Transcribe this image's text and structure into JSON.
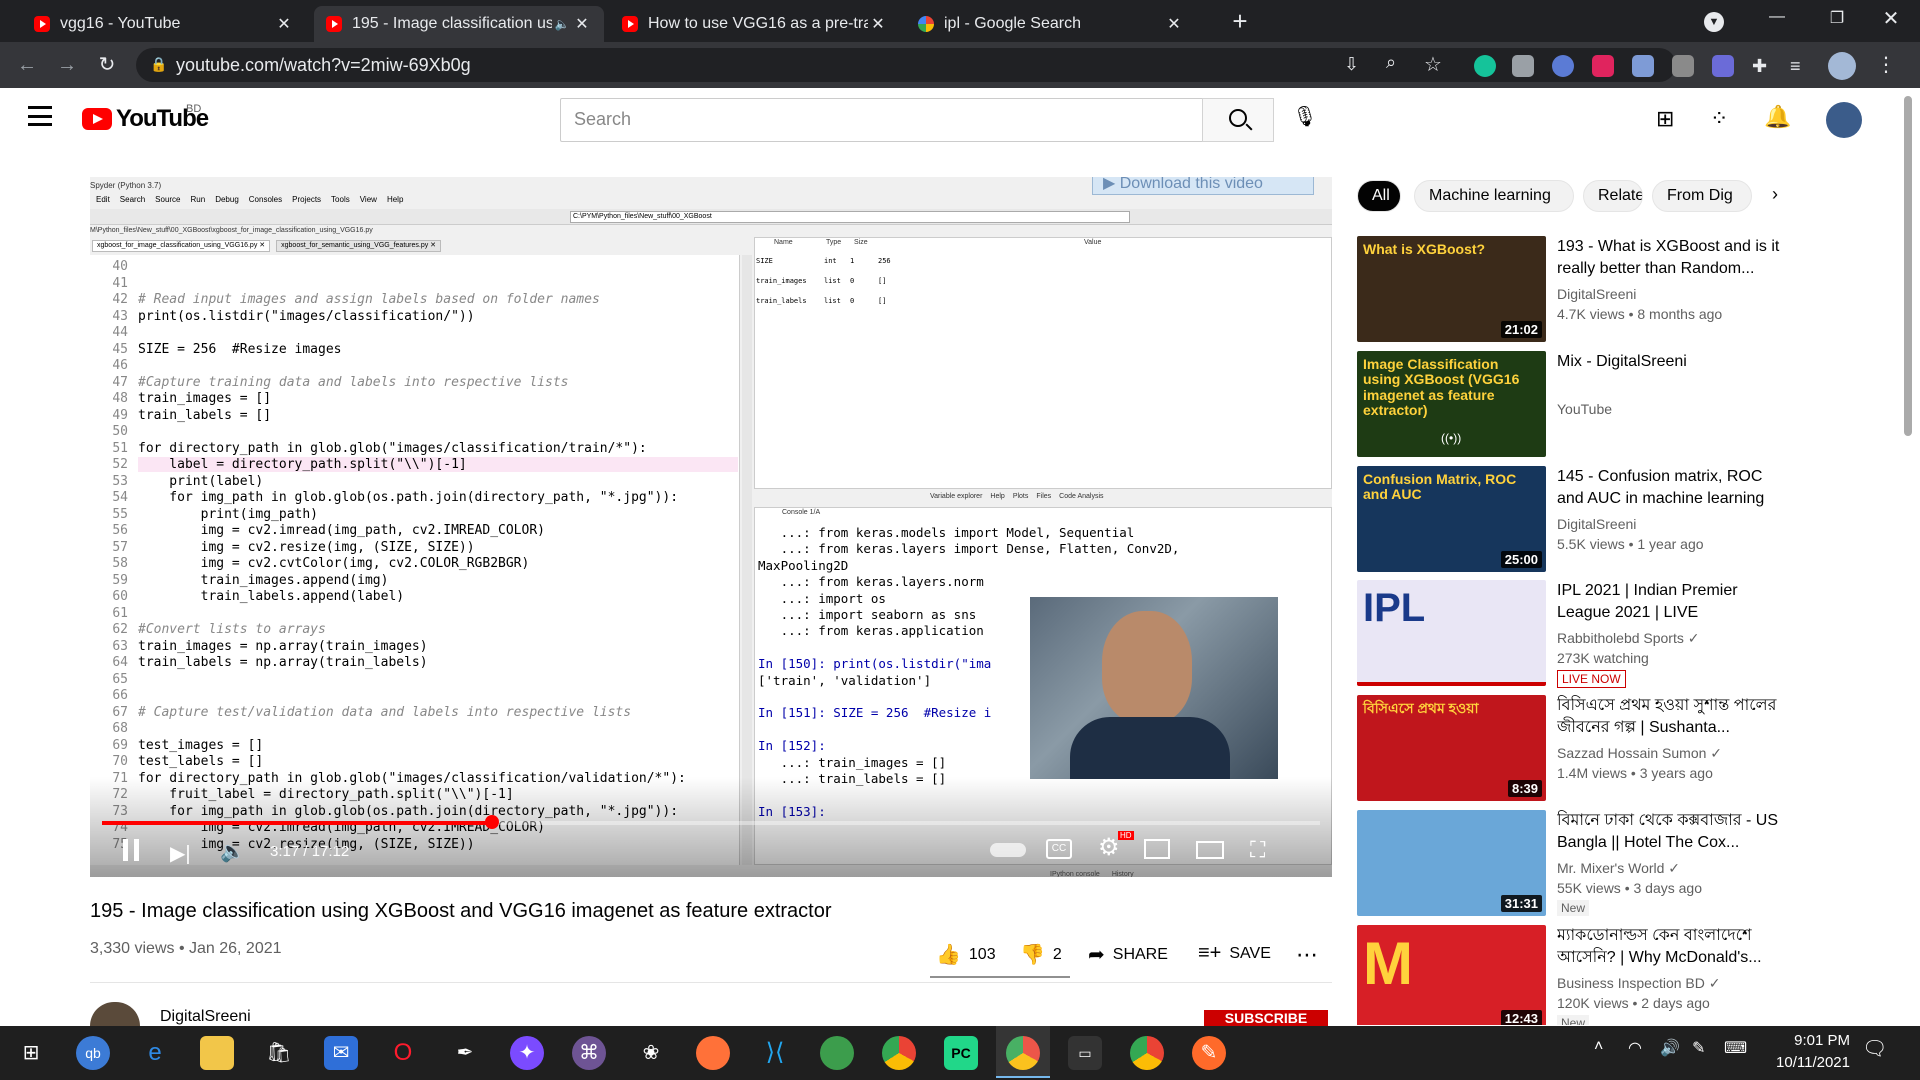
{
  "browser": {
    "tabs": [
      {
        "title": "vgg16 - YouTube",
        "icon": "youtube-icon",
        "active": false
      },
      {
        "title": "195 - Image classification usi",
        "icon": "youtube-icon",
        "active": true
      },
      {
        "title": "How to use VGG16 as a pre-train",
        "icon": "youtube-icon",
        "active": false
      },
      {
        "title": "ipl - Google Search",
        "icon": "google-icon",
        "active": false
      }
    ],
    "new_tab": "+",
    "url": "youtube.com/watch?v=2miw-69Xb0g"
  },
  "youtube": {
    "logo_text": "YouTube",
    "country_code": "BD",
    "search_placeholder": "Search"
  },
  "player": {
    "spyder_title": "Spyder (Python 3.7)",
    "menu": [
      "Edit",
      "Search",
      "Source",
      "Run",
      "Debug",
      "Consoles",
      "Projects",
      "Tools",
      "View",
      "Help"
    ],
    "path": "C:\\PYM\\Python_files\\New_stuff\\00_XGBoost",
    "file_path": "M\\Python_files\\New_stuff\\00_XGBoost\\xgboost_for_image_classification_using_VGG16.py",
    "editor_tabs": [
      "xgboost_for_image_classification_using_VGG16.py",
      "xgboost_for_semantic_using_VGG_features.py"
    ],
    "download_banner": "Download this video",
    "code_lines": [
      {
        "n": "40",
        "t": ""
      },
      {
        "n": "41",
        "t": ""
      },
      {
        "n": "42",
        "t": "# Read input images and assign labels based on folder names",
        "c": "cm"
      },
      {
        "n": "43",
        "t": "print(os.listdir(\"images/classification/\"))"
      },
      {
        "n": "44",
        "t": ""
      },
      {
        "n": "45",
        "t": "SIZE = 256  #Resize images"
      },
      {
        "n": "46",
        "t": ""
      },
      {
        "n": "47",
        "t": "#Capture training data and labels into respective lists",
        "c": "cm"
      },
      {
        "n": "48",
        "t": "train_images = []"
      },
      {
        "n": "49",
        "t": "train_labels = []"
      },
      {
        "n": "50",
        "t": ""
      },
      {
        "n": "51",
        "t": "for directory_path in glob.glob(\"images/classification/train/*\"):"
      },
      {
        "n": "52",
        "t": "    label = directory_path.split(\"\\\\\")[-1]"
      },
      {
        "n": "53",
        "t": "    print(label)"
      },
      {
        "n": "54",
        "t": "    for img_path in glob.glob(os.path.join(directory_path, \"*.jpg\")):"
      },
      {
        "n": "55",
        "t": "        print(img_path)"
      },
      {
        "n": "56",
        "t": "        img = cv2.imread(img_path, cv2.IMREAD_COLOR)"
      },
      {
        "n": "57",
        "t": "        img = cv2.resize(img, (SIZE, SIZE))"
      },
      {
        "n": "58",
        "t": "        img = cv2.cvtColor(img, cv2.COLOR_RGB2BGR)"
      },
      {
        "n": "59",
        "t": "        train_images.append(img)"
      },
      {
        "n": "60",
        "t": "        train_labels.append(label)"
      },
      {
        "n": "61",
        "t": ""
      },
      {
        "n": "62",
        "t": "#Convert lists to arrays",
        "c": "cm"
      },
      {
        "n": "63",
        "t": "train_images = np.array(train_images)"
      },
      {
        "n": "64",
        "t": "train_labels = np.array(train_labels)"
      },
      {
        "n": "65",
        "t": ""
      },
      {
        "n": "66",
        "t": ""
      },
      {
        "n": "67",
        "t": "# Capture test/validation data and labels into respective lists",
        "c": "cm"
      },
      {
        "n": "68",
        "t": ""
      },
      {
        "n": "69",
        "t": "test_images = []"
      },
      {
        "n": "70",
        "t": "test_labels = []"
      },
      {
        "n": "71",
        "t": "for directory_path in glob.glob(\"images/classification/validation/*\"):"
      },
      {
        "n": "72",
        "t": "    fruit_label = directory_path.split(\"\\\\\")[-1]"
      },
      {
        "n": "73",
        "t": "    for img_path in glob.glob(os.path.join(directory_path, \"*.jpg\")):"
      },
      {
        "n": "74",
        "t": "        img = cv2.imread(img_path, cv2.IMREAD_COLOR)"
      },
      {
        "n": "75",
        "t": "        img = cv2.resize(img, (SIZE, SIZE))"
      }
    ],
    "var_headers": [
      "Name",
      "Type",
      "Size",
      "Value"
    ],
    "variables": [
      {
        "name": "SIZE",
        "type": "int",
        "size": "1",
        "value": "256"
      },
      {
        "name": "train_images",
        "type": "list",
        "size": "0",
        "value": "[]"
      },
      {
        "name": "train_labels",
        "type": "list",
        "size": "0",
        "value": "[]"
      }
    ],
    "pane_tabs": [
      "Variable explorer",
      "Help",
      "Plots",
      "Files",
      "Code Analysis"
    ],
    "console_tab": "Console 1/A",
    "console_lines": [
      "   ...: from keras.models import Model, Sequential",
      "   ...: from keras.layers import Dense, Flatten, Conv2D,",
      "MaxPooling2D",
      "   ...: from keras.layers.norm",
      "   ...: import os",
      "   ...: import seaborn as sns",
      "   ...: from keras.application",
      "",
      "In [150]: print(os.listdir(\"ima",
      "['train', 'validation']",
      "",
      "In [151]: SIZE = 256  #Resize i",
      "",
      "In [152]:",
      "   ...: train_images = []",
      "   ...: train_labels = []",
      "",
      "In [153]:"
    ],
    "bottom_tabs": [
      "IPython console",
      "History"
    ],
    "time": "3:17 / 17:12",
    "progress": 0.32
  },
  "video": {
    "title": "195 - Image classification using XGBoost and VGG16 imagenet as feature extractor",
    "meta": "3,330 views • Jan 26, 2021",
    "likes": "103",
    "dislikes": "2",
    "share": "SHARE",
    "save": "SAVE",
    "channel": "DigitalSreeni",
    "subscribe": "SUBSCRIBE"
  },
  "chips": [
    "All",
    "Machine learning",
    "Related",
    "From Dig"
  ],
  "recommendations": [
    {
      "title": "193 - What is XGBoost and is it really better than Random...",
      "channel": "DigitalSreeni",
      "meta": "4.7K views • 8 months ago",
      "duration": "21:02",
      "thumb_text": "What is XGBoost?",
      "thumb_color": "#3b2a1a"
    },
    {
      "title": "Mix - DigitalSreeni",
      "channel": "YouTube",
      "meta": "",
      "duration": "",
      "thumb_text": "Image Classification using XGBoost (VGG16 imagenet as feature extractor)",
      "thumb_color": "#1e3b14"
    },
    {
      "title": "145 - Confusion matrix, ROC and AUC in machine learning",
      "channel": "DigitalSreeni",
      "meta": "5.5K views • 1 year ago",
      "duration": "25:00",
      "thumb_text": "Confusion Matrix, ROC and AUC",
      "thumb_color": "#16365c"
    },
    {
      "title": "IPL 2021 | Indian Premier League 2021 | LIVE",
      "channel": "Rabbitholebd Sports",
      "meta": "273K watching",
      "badge": "LIVE NOW",
      "duration": "",
      "thumb_text": "IPL",
      "thumb_color": "#e9e6f5"
    },
    {
      "title": "বিসিএসে প্রথম হওয়া সুশান্ত পালের জীবনের গল্প | Sushanta...",
      "channel": "Sazzad Hossain Sumon",
      "meta": "1.4M views • 3 years ago",
      "duration": "8:39",
      "thumb_text": "বিসিএসে প্রথম হওয়া",
      "thumb_color": "#c0161c"
    },
    {
      "title": "বিমানে ঢাকা থেকে কক্সবাজার - US Bangla || Hotel The Cox...",
      "channel": "Mr. Mixer's World",
      "meta": "55K views • 3 days ago",
      "badge": "New",
      "duration": "31:31",
      "thumb_text": "",
      "thumb_color": "#6aa7d8"
    },
    {
      "title": "ম্যাকডোনাল্ডস কেন বাংলাদেশে আসেনি? | Why McDonald's...",
      "channel": "Business Inspection BD",
      "meta": "120K views • 2 days ago",
      "badge": "New",
      "duration": "12:43",
      "thumb_text": "M",
      "thumb_color": "#d71f26"
    }
  ],
  "taskbar": {
    "time": "9:01 PM",
    "date": "10/11/2021"
  }
}
